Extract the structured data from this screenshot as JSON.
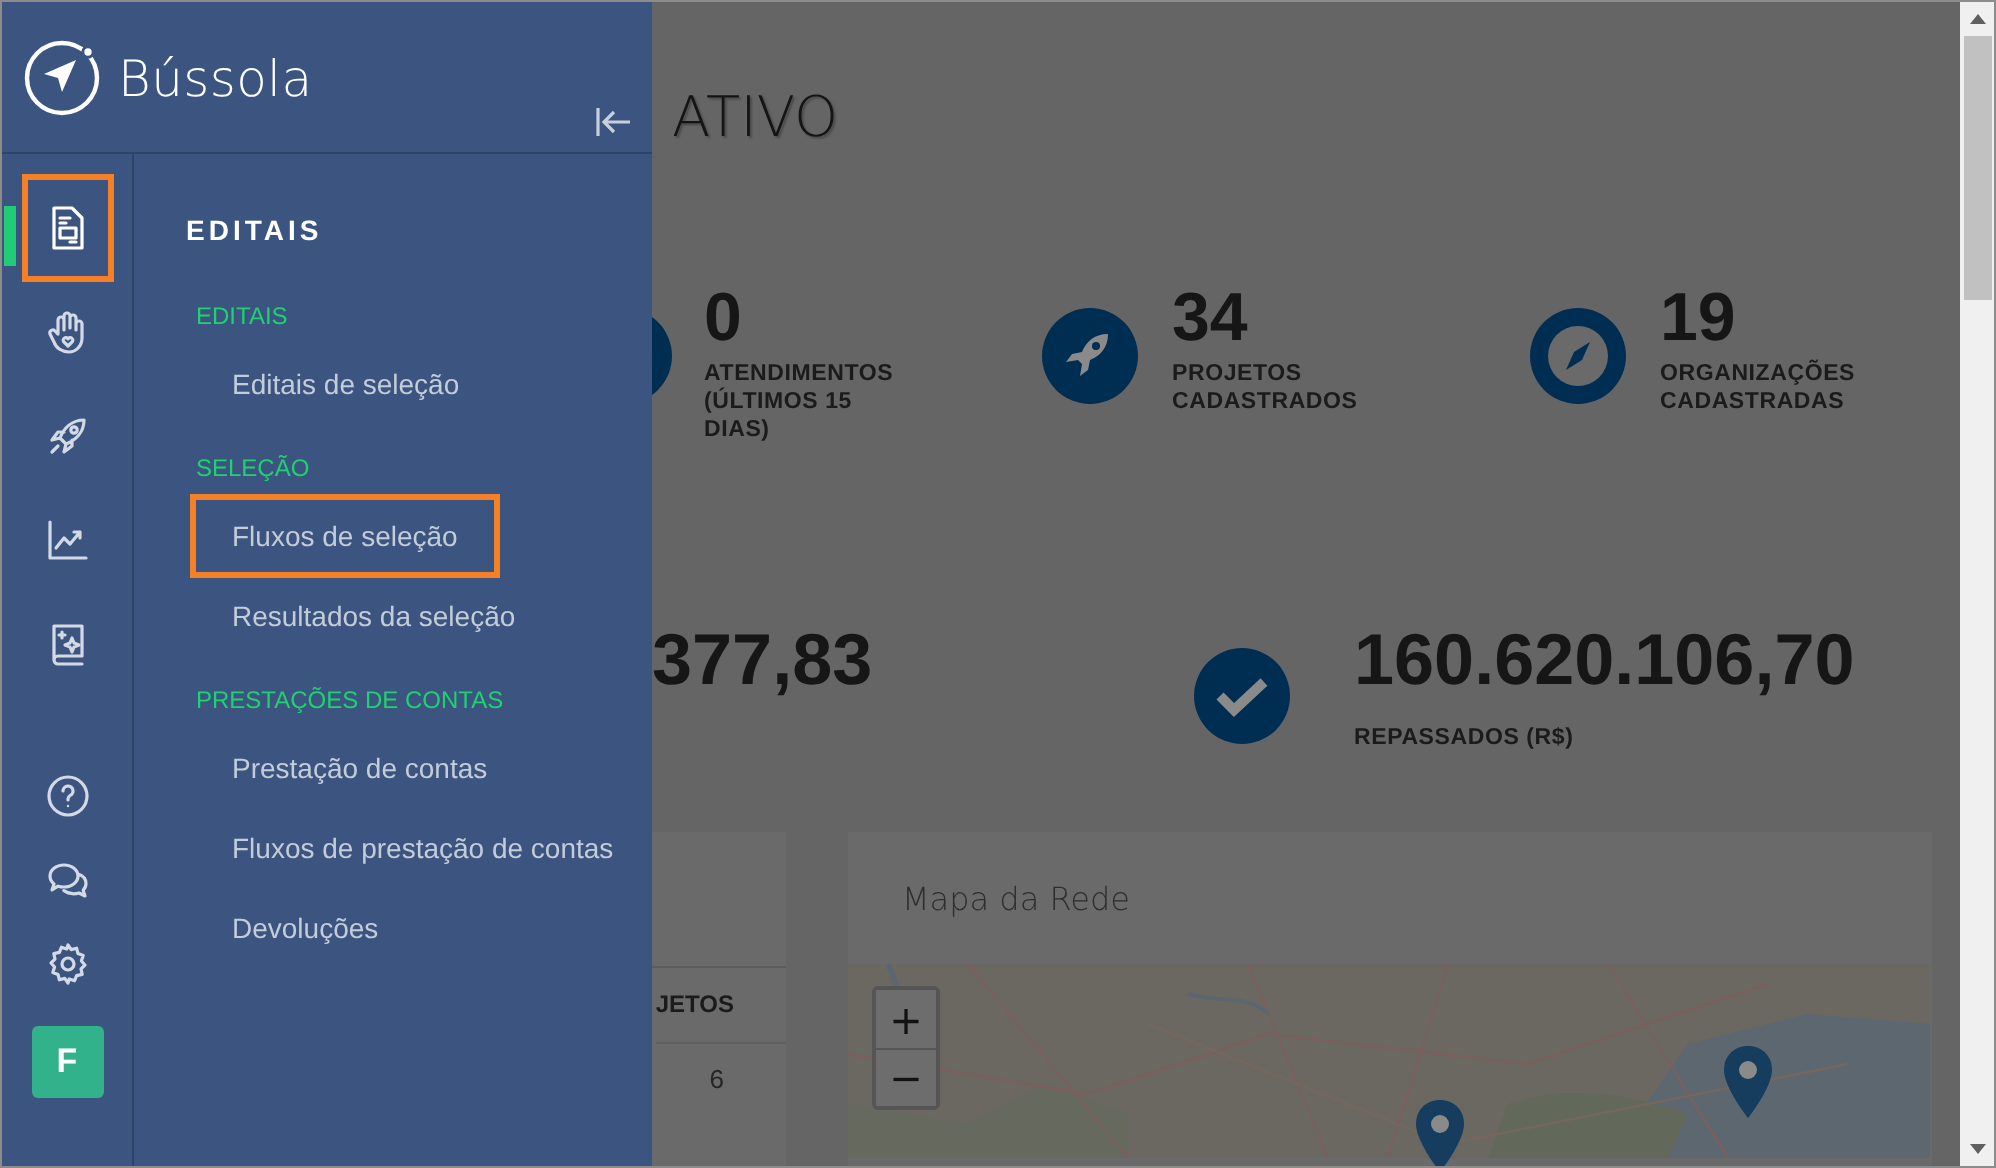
{
  "app": {
    "name": "Bússola"
  },
  "nav_icons": [
    {
      "kind": "document",
      "selected": true,
      "highlighted": true
    },
    {
      "kind": "hand",
      "selected": false,
      "highlighted": false
    },
    {
      "kind": "rocket",
      "selected": false,
      "highlighted": false
    },
    {
      "kind": "chart",
      "selected": false,
      "highlighted": false
    },
    {
      "kind": "book",
      "selected": false,
      "highlighted": false
    }
  ],
  "nav_bottom": [
    {
      "kind": "help"
    },
    {
      "kind": "chat"
    },
    {
      "kind": "settings"
    }
  ],
  "avatar": "F",
  "menu": {
    "title": "EDITAIS",
    "sections": [
      {
        "label": "EDITAIS",
        "items": [
          {
            "label": "Editais de seleção",
            "highlighted": false
          }
        ]
      },
      {
        "label": "SELEÇÃO",
        "items": [
          {
            "label": "Fluxos de seleção",
            "highlighted": true
          },
          {
            "label": "Resultados da seleção",
            "highlighted": false
          }
        ]
      },
      {
        "label": "PRESTAÇÕES DE CONTAS",
        "items": [
          {
            "label": "Prestação de contas",
            "highlighted": false
          },
          {
            "label": "Fluxos de prestação de contas",
            "highlighted": false
          },
          {
            "label": "Devoluções",
            "highlighted": false
          }
        ]
      }
    ]
  },
  "page": {
    "title": "ATIVO",
    "stats": [
      {
        "value": "0",
        "label": "ATENDIMENTOS (ÚLTIMOS 15 DIAS)"
      },
      {
        "value": "34",
        "label": "PROJETOS CADASTRADOS"
      },
      {
        "value": "19",
        "label": "ORGANIZAÇÕES CADASTRADAS"
      }
    ],
    "totals": [
      {
        "value": "377,83"
      },
      {
        "value": "160.620.106,70",
        "label": "REPASSADOS (R$)"
      }
    ],
    "table": {
      "column": "JETOS",
      "cells": [
        "6"
      ]
    },
    "map": {
      "title": "Mapa da Rede",
      "zoom_in": "+",
      "zoom_out": "−"
    }
  }
}
